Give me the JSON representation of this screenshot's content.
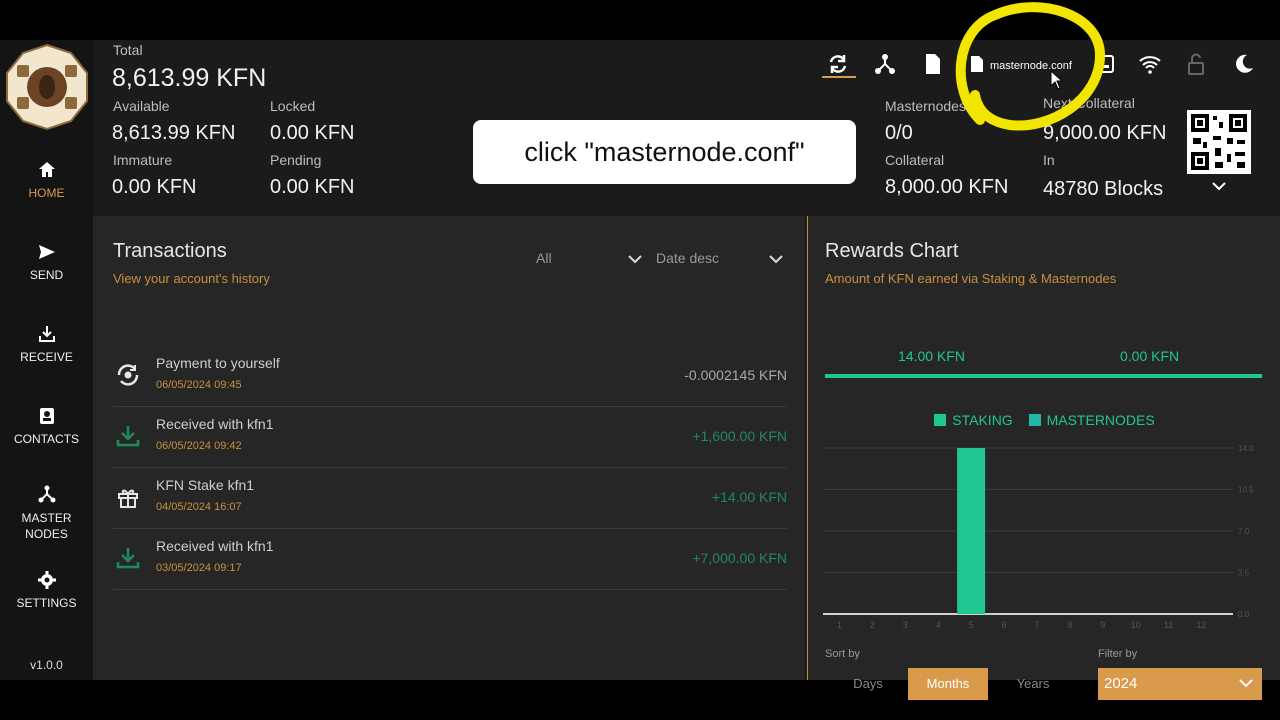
{
  "header": {
    "total_label": "Total",
    "total_value": "8,613.99 KFN",
    "available_label": "Available",
    "available_value": "8,613.99 KFN",
    "locked_label": "Locked",
    "locked_value": "0.00 KFN",
    "immature_label": "Immature",
    "immature_value": "0.00 KFN",
    "pending_label": "Pending",
    "pending_value": "0.00 KFN",
    "masternodes_label": "Masternodes",
    "masternodes_value": "0/0",
    "next_collateral_label": "Next Collateral",
    "next_collateral_value": "9,000.00 KFN",
    "collateral_label": "Collateral",
    "collateral_value": "8,000.00 KFN",
    "in_label": "In",
    "in_value": "48780 Blocks",
    "tooltip": "masternode.conf"
  },
  "sidebar": {
    "items": [
      {
        "label": "HOME",
        "icon": "home-icon"
      },
      {
        "label": "SEND",
        "icon": "send-icon"
      },
      {
        "label": "RECEIVE",
        "icon": "receive-icon"
      },
      {
        "label": "CONTACTS",
        "icon": "contacts-icon"
      },
      {
        "label": "MASTER\nNODES",
        "icon": "masternodes-icon"
      },
      {
        "label": "SETTINGS",
        "icon": "gear-icon"
      }
    ],
    "version": "v1.0.0"
  },
  "transactions": {
    "title": "Transactions",
    "subtitle": "View your account's history",
    "filter_type": "All",
    "filter_sort": "Date desc",
    "rows": [
      {
        "name": "Payment to yourself",
        "date": "06/05/2024 09:45",
        "amount": "-0.0002145 KFN",
        "icon": "self-payment-icon"
      },
      {
        "name": "Received with kfn1",
        "date": "06/05/2024 09:42",
        "amount": "+1,600.00 KFN",
        "icon": "download-icon"
      },
      {
        "name": "KFN Stake kfn1",
        "date": "04/05/2024 16:07",
        "amount": "+14.00 KFN",
        "icon": "gift-icon"
      },
      {
        "name": "Received with kfn1",
        "date": "03/05/2024 09:17",
        "amount": "+7,000.00 KFN",
        "icon": "download-icon"
      }
    ]
  },
  "rewards": {
    "title": "Rewards Chart",
    "subtitle": "Amount of KFN earned via Staking & Masternodes",
    "staking_total": "14.00 KFN",
    "masternodes_total": "0.00 KFN",
    "sort_label": "Sort by",
    "filter_label": "Filter by",
    "sort_days": "Days",
    "sort_months": "Months",
    "sort_years": "Years",
    "year": "2024"
  },
  "chart_data": {
    "type": "bar",
    "categories": [
      "1",
      "2",
      "3",
      "4",
      "5",
      "6",
      "7",
      "8",
      "9",
      "10",
      "11",
      "12"
    ],
    "series": [
      {
        "name": "STAKING",
        "values": [
          0,
          0,
          0,
          0,
          14,
          0,
          0,
          0,
          0,
          0,
          0,
          0
        ],
        "color": "#21c793"
      },
      {
        "name": "MASTERNODES",
        "values": [
          0,
          0,
          0,
          0,
          0,
          0,
          0,
          0,
          0,
          0,
          0,
          0
        ],
        "color": "#1fb7a6"
      }
    ],
    "yticks": [
      "0.0",
      "3.5",
      "7.0",
      "10.5",
      "14.0"
    ],
    "ylim": [
      0,
      14
    ],
    "grid": true,
    "legend": "top"
  },
  "overlay": {
    "instruction": "click \"masternode.conf\""
  },
  "colors": {
    "accent": "#d99a4c",
    "green": "#21c793",
    "bg": "#1b1b1b"
  }
}
